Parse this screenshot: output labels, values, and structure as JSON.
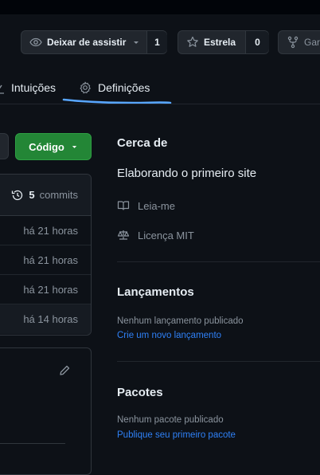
{
  "repo_actions": {
    "watch_label": "Deixar de assistir",
    "watch_count": "1",
    "star_label": "Estrela",
    "star_count": "0",
    "fork_label": "Garfo"
  },
  "tabs": [
    {
      "label": "Intuições"
    },
    {
      "label": "Definições"
    }
  ],
  "code_button": {
    "label": "Código"
  },
  "commits": {
    "count": "5",
    "label": "commits",
    "rows": [
      "há 21 horas",
      "há 21 horas",
      "há 21 horas",
      "há 14 horas"
    ]
  },
  "about": {
    "title": "Cerca de",
    "description": "Elaborando o primeiro site",
    "readme": "Leia-me",
    "license": "Licença MIT"
  },
  "releases": {
    "title": "Lançamentos",
    "empty": "Nenhum lançamento publicado",
    "link": "Crie um novo lançamento"
  },
  "packages": {
    "title": "Pacotes",
    "empty": "Nenhum pacote publicado",
    "link": "Publique seu primeiro pacote"
  },
  "colors": {
    "background": "#0d1117",
    "accent_link": "#2f81f7",
    "code_button": "#238636",
    "annotation_stroke": "#58a6ff"
  }
}
